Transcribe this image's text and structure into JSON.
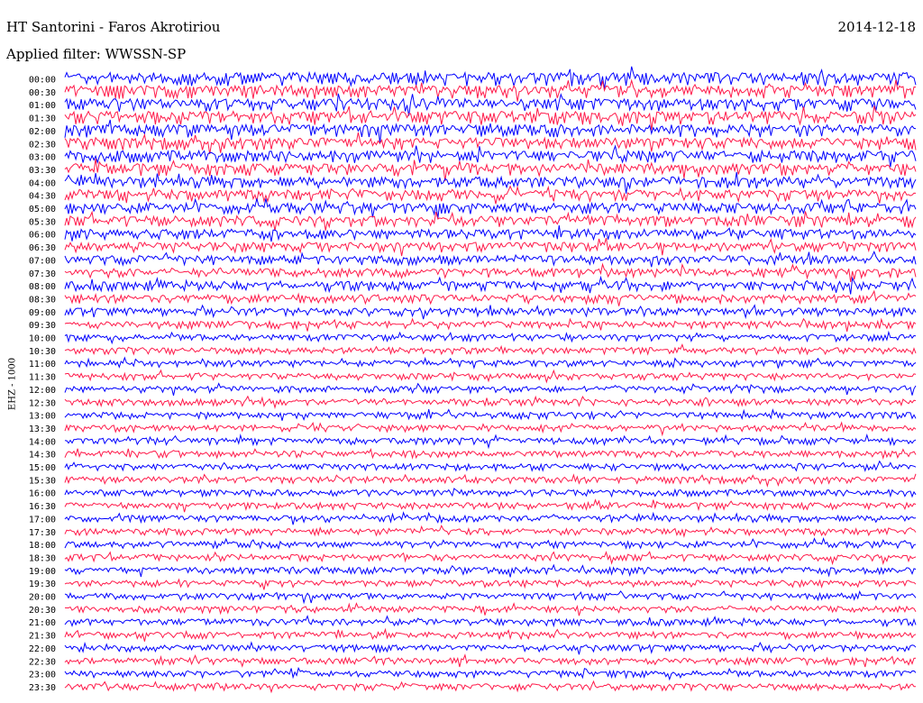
{
  "header": {
    "station": "HT Santorini - Faros Akrotiriou",
    "date": "2014-12-18",
    "filter": "Applied filter: WWSSN-SP"
  },
  "chart_data": {
    "type": "line",
    "title": "HT Santorini - Faros Akrotiriou",
    "ylabel": "EHZ - 1000",
    "row_labels": [
      "00:00",
      "00:30",
      "01:00",
      "01:30",
      "02:00",
      "02:30",
      "03:00",
      "03:30",
      "04:00",
      "04:30",
      "05:00",
      "05:30",
      "06:00",
      "06:30",
      "07:00",
      "07:30",
      "08:00",
      "08:30",
      "09:00",
      "09:30",
      "10:00",
      "10:30",
      "11:00",
      "11:30",
      "12:00",
      "12:30",
      "13:00",
      "13:30",
      "14:00",
      "14:30",
      "15:00",
      "15:30",
      "16:00",
      "16:30",
      "17:00",
      "17:30",
      "18:00",
      "18:30",
      "19:00",
      "19:30",
      "20:00",
      "20:30",
      "21:00",
      "21:30",
      "22:00",
      "22:30",
      "23:00",
      "23:30"
    ],
    "row_amplitude": [
      1.0,
      1.0,
      0.95,
      1.0,
      0.95,
      0.9,
      0.9,
      0.9,
      0.85,
      0.85,
      0.8,
      0.8,
      0.75,
      0.75,
      0.7,
      0.7,
      0.7,
      0.65,
      0.6,
      0.55,
      0.5,
      0.5,
      0.5,
      0.5,
      0.5,
      0.5,
      0.5,
      0.5,
      0.5,
      0.5,
      0.5,
      0.5,
      0.5,
      0.5,
      0.5,
      0.5,
      0.5,
      0.5,
      0.5,
      0.5,
      0.5,
      0.5,
      0.5,
      0.5,
      0.5,
      0.5,
      0.5,
      0.5
    ],
    "series_colors": [
      "#0000ff",
      "#ff1a4a"
    ],
    "grid": false
  }
}
